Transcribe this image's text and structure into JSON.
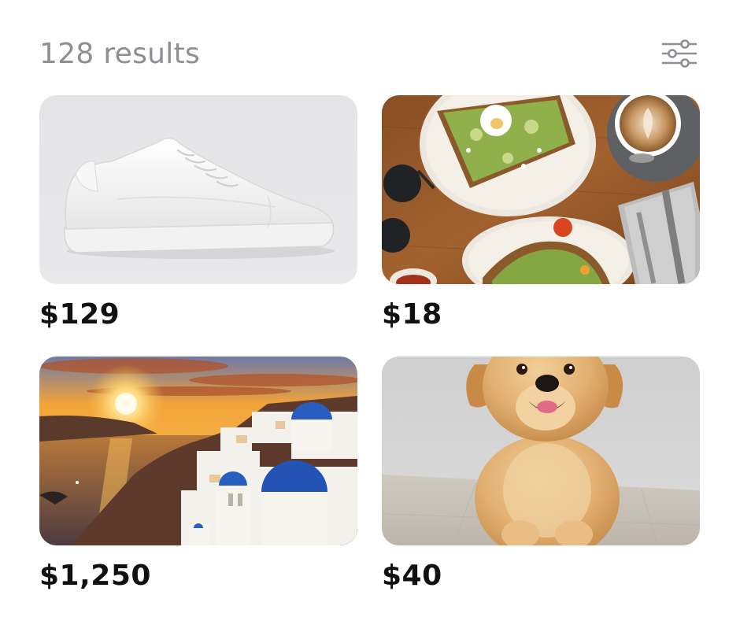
{
  "header": {
    "results_text": "128 results",
    "filter_icon": "sliders-icon"
  },
  "colors": {
    "muted_text": "#8e8e93",
    "price_text": "#111111",
    "background": "#ffffff"
  },
  "items": [
    {
      "price": "$129",
      "image": "white-sneaker"
    },
    {
      "price": "$18",
      "image": "avocado-toast-and-coffee"
    },
    {
      "price": "$1,250",
      "image": "santorini-sunset"
    },
    {
      "price": "$40",
      "image": "golden-retriever-puppy"
    }
  ]
}
